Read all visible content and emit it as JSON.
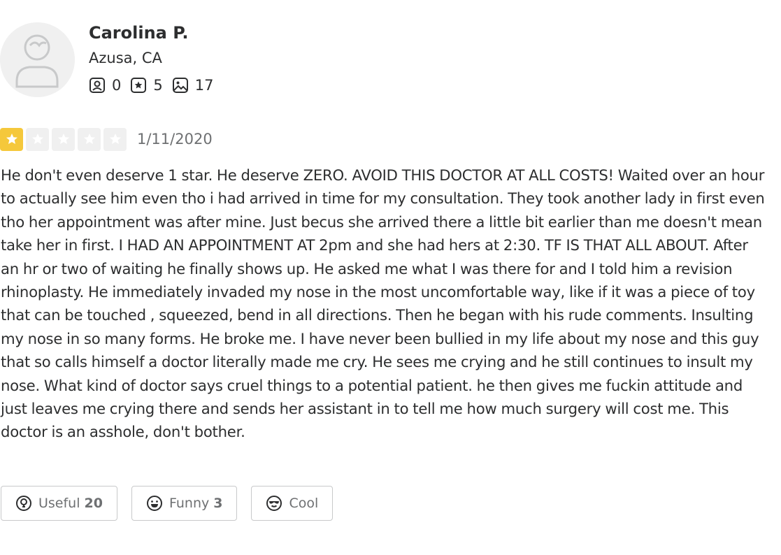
{
  "user": {
    "name": "Carolina P.",
    "location": "Azusa, CA",
    "friends": "0",
    "reviews": "5",
    "photos": "17"
  },
  "review": {
    "rating": 1,
    "rating_max": 5,
    "date": "1/11/2020",
    "text": "He don't even deserve 1 star. He deserve ZERO. AVOID THIS DOCTOR AT ALL COSTS!  Waited over an hour to actually see him even tho i had arrived in time for my consultation. They took another lady in first even tho her appointment was after mine. Just becus she arrived there a little bit earlier than me doesn't mean take her in first. I HAD AN APPOINTMENT AT 2pm and she had hers at 2:30. TF IS THAT ALL ABOUT. After an hr or two of waiting he finally shows up. He asked me what I was there for and I told him a revision rhinoplasty. He immediately invaded my nose in the most uncomfortable way, like if it was a piece of toy that can be touched , squeezed, bend in all directions. Then he began with his rude comments. Insulting my nose in so many forms. He broke me. I have never been bullied in my life about my nose and this guy that so calls himself a doctor literally made me cry. He sees me crying and he still continues to insult my nose. What kind of doctor says cruel things to a potential patient. he then gives me fuckin attitude and just leaves me crying there and sends her assistant in to tell me how much surgery will cost me. This doctor is an asshole, don't bother."
  },
  "reactions": {
    "useful_label": "Useful",
    "useful_count": "20",
    "funny_label": "Funny",
    "funny_count": "3",
    "cool_label": "Cool"
  },
  "colors": {
    "star_on": "#f5c83b",
    "star_off": "#f0f0f0",
    "text": "#2d2e2f",
    "muted": "#6e7072",
    "border": "#c8c9ca"
  },
  "icons": {
    "avatar": "default-user-avatar",
    "friends": "friends-icon",
    "reviews": "reviews-star-icon",
    "photos": "photos-icon",
    "useful": "lightbulb-icon",
    "funny": "smile-icon",
    "cool": "sunglasses-icon"
  }
}
